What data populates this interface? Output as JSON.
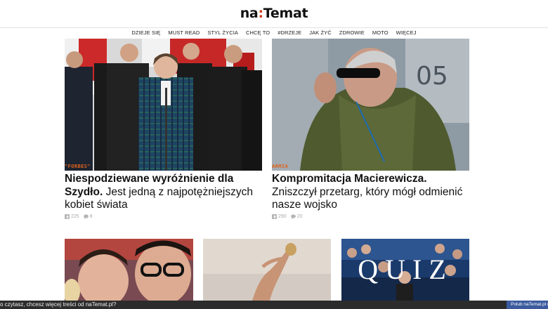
{
  "header": {
    "logo_left": "na",
    "logo_colon": ":",
    "logo_right": "Temat"
  },
  "nav": [
    "DZIEJE SIĘ",
    "MUST READ",
    "STYL ŻYCIA",
    "CHCĘ TO",
    "#DRZEJE",
    "JAK ŻYĆ",
    "ZDROWIE",
    "MOTO",
    "WIĘCEJ"
  ],
  "articles": [
    {
      "category": "\"FORBES\"",
      "title_bold": "Niespodziewane wyróżnienie dla Szydło.",
      "title_rest": " Jest jedną z najpotężniejszych kobiet świata",
      "likes": "225",
      "comments": "8"
    },
    {
      "category": "ARMIA",
      "title_bold": "Kompromitacja Macierewicza.",
      "title_rest": " Zniszczył przetarg, który mógł odmienić nasze wojsko",
      "likes": "290",
      "comments": "20"
    }
  ],
  "quiz_tile": {
    "label": "QUIZ"
  },
  "footer": {
    "text": "o czytasz, chcesz więcej treści od naTemat.pl?",
    "fb_button": "Polub naTemat.pl na"
  },
  "colors": {
    "accent": "#e0611a",
    "brand_red": "#d33b1e",
    "facebook": "#3b5b9e"
  },
  "icons": [
    "facebook-like-icon",
    "comment-bubble-icon"
  ]
}
